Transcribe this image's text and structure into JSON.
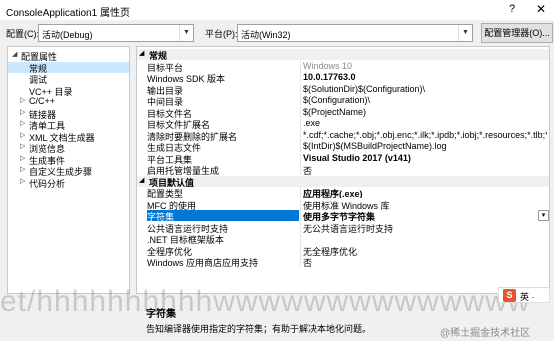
{
  "window": {
    "title": "ConsoleApplication1 属性页",
    "help": "?",
    "close": "✕"
  },
  "toolbar": {
    "config_label": "配置(C):",
    "config_value": "活动(Debug)",
    "platform_label": "平台(P):",
    "platform_value": "活动(Win32)",
    "config_manager": "配置管理器(O)..."
  },
  "tree": [
    {
      "label": "配置属性",
      "arrow": "◢",
      "indent": 0
    },
    {
      "label": "常规",
      "arrow": "",
      "indent": 1
    },
    {
      "label": "调试",
      "arrow": "",
      "indent": 1
    },
    {
      "label": "VC++ 目录",
      "arrow": "",
      "indent": 1
    },
    {
      "label": "C/C++",
      "arrow": "▷",
      "indent": 1
    },
    {
      "label": "链接器",
      "arrow": "▷",
      "indent": 1
    },
    {
      "label": "清单工具",
      "arrow": "▷",
      "indent": 1
    },
    {
      "label": "XML 文档生成器",
      "arrow": "▷",
      "indent": 1
    },
    {
      "label": "浏览信息",
      "arrow": "▷",
      "indent": 1
    },
    {
      "label": "生成事件",
      "arrow": "▷",
      "indent": 1
    },
    {
      "label": "自定义生成步骤",
      "arrow": "▷",
      "indent": 1
    },
    {
      "label": "代码分析",
      "arrow": "▷",
      "indent": 1
    }
  ],
  "categories": {
    "general": {
      "label": "常规",
      "arrow": "◢"
    },
    "defaults": {
      "label": "项目默认值",
      "arrow": "◢"
    }
  },
  "general_props": [
    {
      "name": "目标平台",
      "value": "Windows 10",
      "style": "g"
    },
    {
      "name": "Windows SDK 版本",
      "value": "10.0.17763.0",
      "style": "b"
    },
    {
      "name": "输出目录",
      "value": "$(SolutionDir)$(Configuration)\\",
      "style": ""
    },
    {
      "name": "中间目录",
      "value": "$(Configuration)\\",
      "style": ""
    },
    {
      "name": "目标文件名",
      "value": "$(ProjectName)",
      "style": ""
    },
    {
      "name": "目标文件扩展名",
      "value": ".exe",
      "style": ""
    },
    {
      "name": "清除时要删除的扩展名",
      "value": "*.cdf;*.cache;*.obj;*.obj.enc;*.ilk;*.ipdb;*.iobj;*.resources;*.tlb;*.tli;*",
      "style": ""
    },
    {
      "name": "生成日志文件",
      "value": "$(IntDir)$(MSBuildProjectName).log",
      "style": ""
    },
    {
      "name": "平台工具集",
      "value": "Visual Studio 2017 (v141)",
      "style": "b"
    },
    {
      "name": "启用托管增量生成",
      "value": "否",
      "style": ""
    }
  ],
  "default_props": [
    {
      "name": "配置类型",
      "value": "应用程序(.exe)",
      "style": "b"
    },
    {
      "name": "MFC 的使用",
      "value": "使用标准 Windows 库",
      "style": ""
    },
    {
      "name": "字符集",
      "value": "使用多字节字符集",
      "style": "b"
    },
    {
      "name": "公共语言运行时支持",
      "value": "无公共语言运行时支持",
      "style": ""
    },
    {
      "name": ".NET 目标框架版本",
      "value": "",
      "style": ""
    },
    {
      "name": "全程序优化",
      "value": "无全程序优化",
      "style": ""
    },
    {
      "name": "Windows 应用商店应用支持",
      "value": "否",
      "style": ""
    }
  ],
  "selected_default_index": 2,
  "dropdown_glyph": "▾",
  "description": {
    "title": "字符集",
    "text": "告知编译器使用指定的字符集；有助于解决本地化问题。"
  },
  "overlay": {
    "watermark": "et/hhhhhhhhhhwwwwwwwwwwwwww",
    "ime_s": "S",
    "ime_text": "英 ·",
    "credit": "@稀土掘金技术社区"
  }
}
